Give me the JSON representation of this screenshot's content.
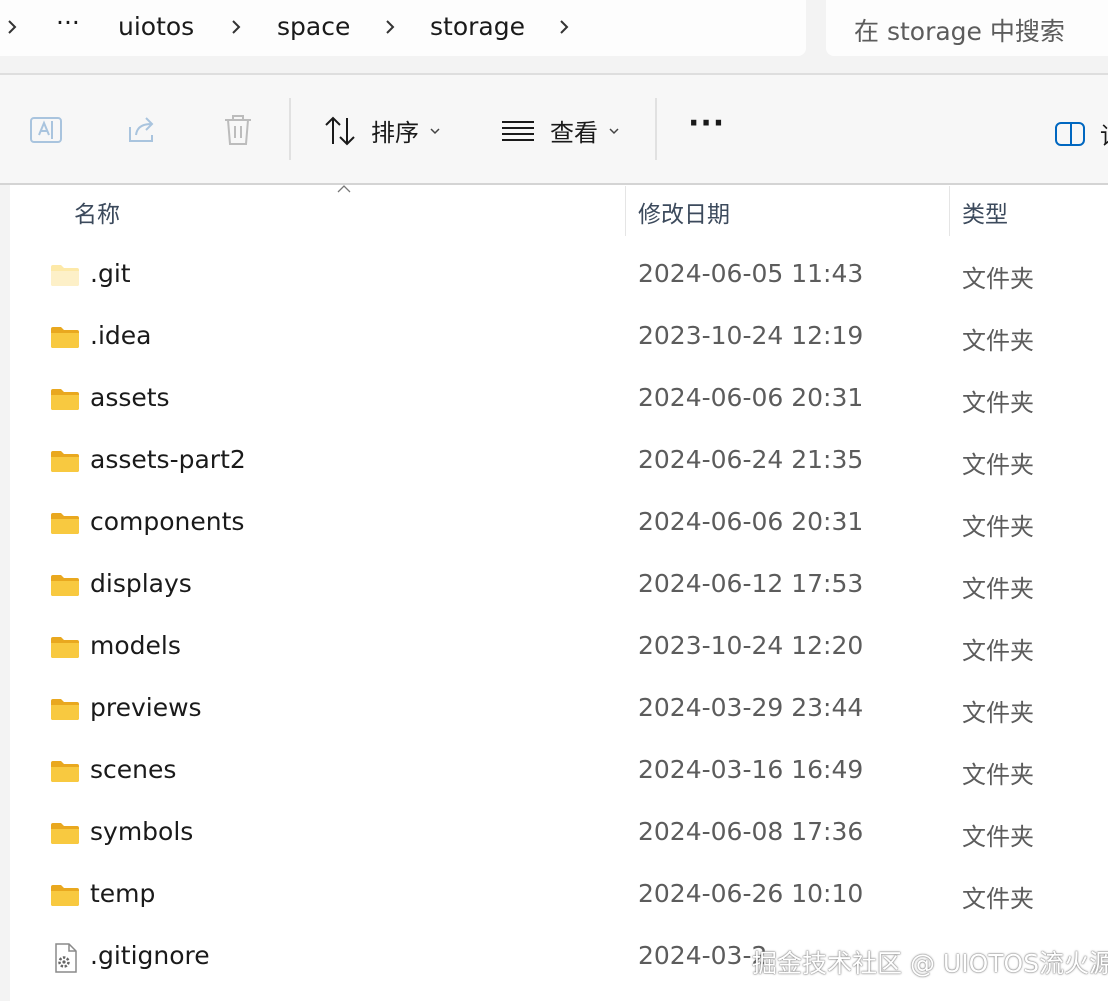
{
  "breadcrumb": {
    "overflow": "···",
    "items": [
      "uiotos",
      "space",
      "storage"
    ]
  },
  "search": {
    "placeholder": "在 storage 中搜索"
  },
  "toolbar": {
    "sort_label": "排序",
    "view_label": "查看",
    "more_label": "···"
  },
  "columns": {
    "name": "名称",
    "modified": "修改日期",
    "type": "类型"
  },
  "files": [
    {
      "name": ".git",
      "modified": "2024-06-05 11:43",
      "type": "文件夹",
      "icon": "hidden-folder-icon"
    },
    {
      "name": ".idea",
      "modified": "2023-10-24 12:19",
      "type": "文件夹",
      "icon": "folder-icon"
    },
    {
      "name": "assets",
      "modified": "2024-06-06 20:31",
      "type": "文件夹",
      "icon": "folder-icon"
    },
    {
      "name": "assets-part2",
      "modified": "2024-06-24 21:35",
      "type": "文件夹",
      "icon": "folder-icon"
    },
    {
      "name": "components",
      "modified": "2024-06-06 20:31",
      "type": "文件夹",
      "icon": "folder-icon"
    },
    {
      "name": "displays",
      "modified": "2024-06-12 17:53",
      "type": "文件夹",
      "icon": "folder-icon"
    },
    {
      "name": "models",
      "modified": "2023-10-24 12:20",
      "type": "文件夹",
      "icon": "folder-icon"
    },
    {
      "name": "previews",
      "modified": "2024-03-29 23:44",
      "type": "文件夹",
      "icon": "folder-icon"
    },
    {
      "name": "scenes",
      "modified": "2024-03-16 16:49",
      "type": "文件夹",
      "icon": "folder-icon"
    },
    {
      "name": "symbols",
      "modified": "2024-06-08 17:36",
      "type": "文件夹",
      "icon": "folder-icon"
    },
    {
      "name": "temp",
      "modified": "2024-06-26 10:10",
      "type": "文件夹",
      "icon": "folder-icon"
    },
    {
      "name": ".gitignore",
      "modified": "2024-03-2",
      "type": "",
      "icon": "settings-file-icon"
    }
  ],
  "watermark": "掘金技术社区 @ UIOTOS流火源",
  "colors": {
    "folder": "#f8c940",
    "folder_light": "#fde9a8",
    "accent": "#0067c0"
  }
}
